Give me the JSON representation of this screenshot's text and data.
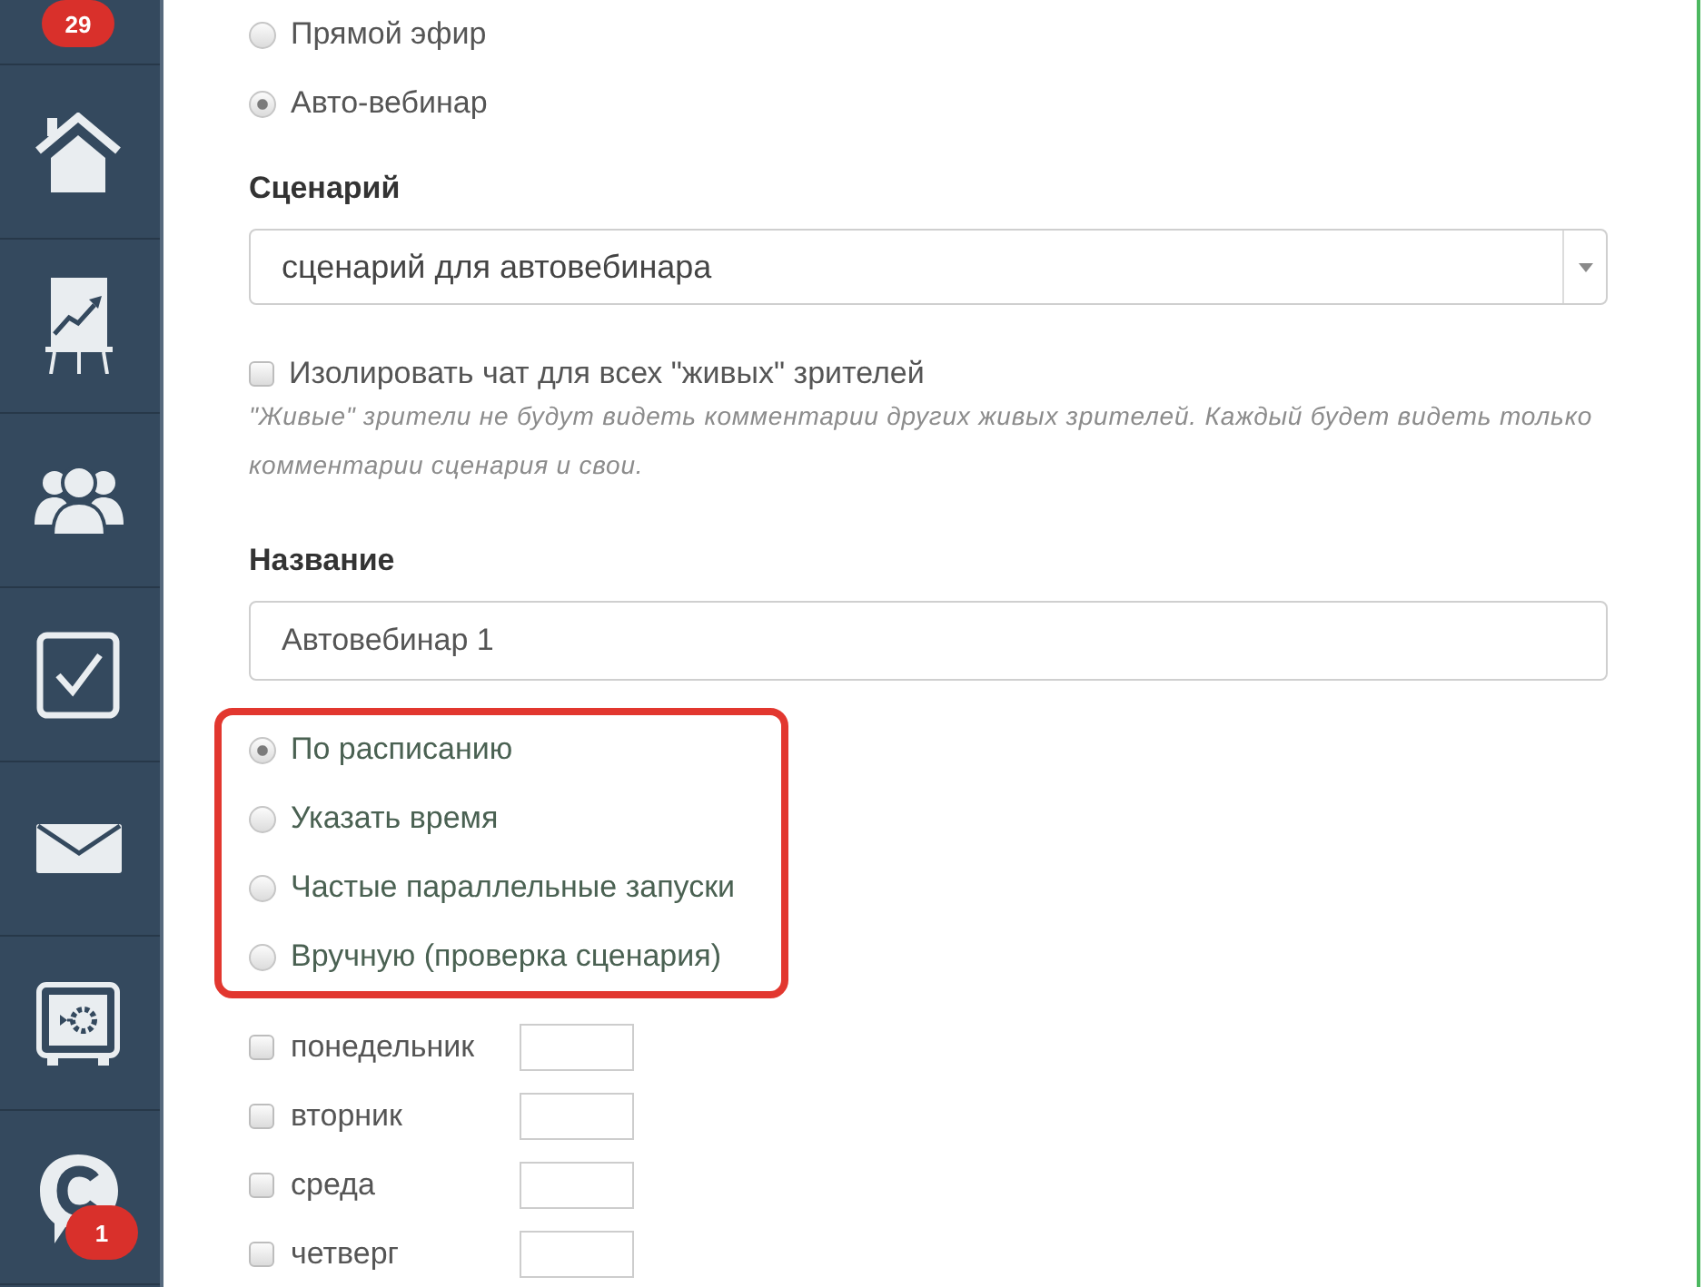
{
  "sidebar": {
    "items": [
      {
        "badge": "29"
      },
      {
        "kind": "home"
      },
      {
        "kind": "chart"
      },
      {
        "kind": "people"
      },
      {
        "kind": "tasks"
      },
      {
        "kind": "mail"
      },
      {
        "kind": "safe"
      },
      {
        "kind": "chat",
        "badge": "1"
      }
    ]
  },
  "broadcast_type": [
    {
      "label": "Прямой эфир",
      "selected": false
    },
    {
      "label": "Авто-вебинар",
      "selected": true
    }
  ],
  "scenario": {
    "label": "Сценарий",
    "value": "сценарий для автовебинара"
  },
  "isolate_chat": {
    "label": "Изолировать чат для всех \"живых\" зрителей",
    "checked": false,
    "hint": "\"Живые\" зрители не будут видеть комментарии других живых зрителей. Каждый будет видеть только комментарии сценария и свои."
  },
  "name": {
    "label": "Название",
    "value": "Автовебинар 1"
  },
  "launch_mode": [
    {
      "label": "По расписанию",
      "selected": true
    },
    {
      "label": "Указать время",
      "selected": false
    },
    {
      "label": "Частые параллельные запуски",
      "selected": false
    },
    {
      "label": "Вручную (проверка сценария)",
      "selected": false
    }
  ],
  "days": [
    {
      "label": "понедельник",
      "checked": false
    },
    {
      "label": "вторник",
      "checked": false
    },
    {
      "label": "среда",
      "checked": false
    },
    {
      "label": "четверг",
      "checked": false
    }
  ]
}
